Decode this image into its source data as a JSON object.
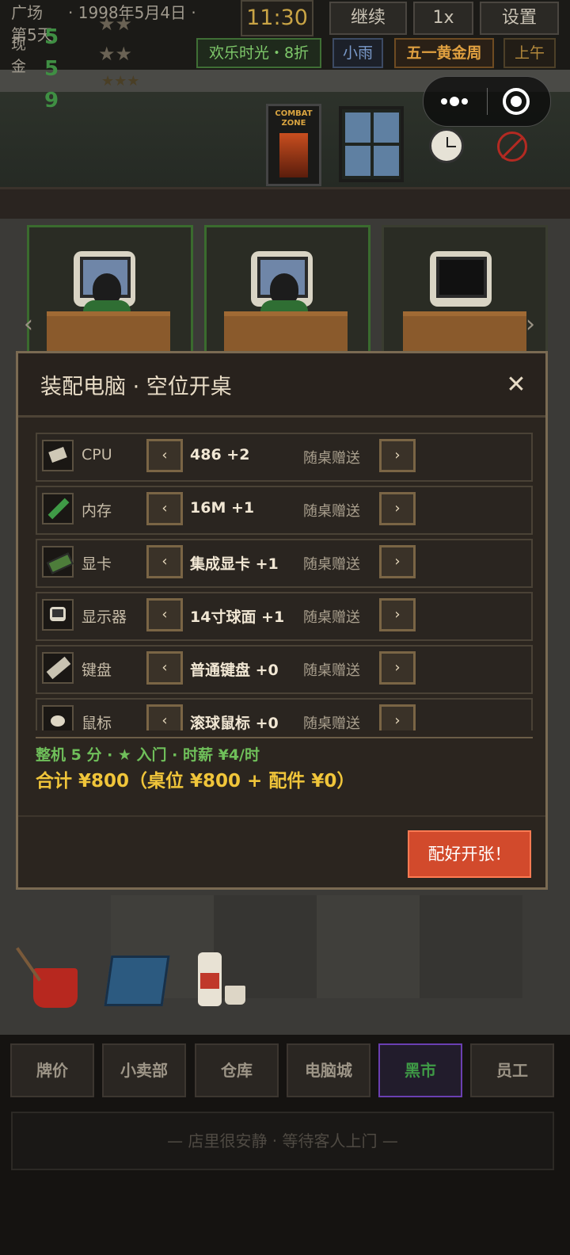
{
  "topbar": {
    "location": "广场",
    "date": "· 1998年5月4日 ·",
    "day": "第5天",
    "cash_label": "现金",
    "cash_digits": [
      "5",
      "5",
      "9"
    ],
    "stars_row1": "★★",
    "stars_row2": "★★",
    "stars_row3": "★★★",
    "clock": "11:30",
    "continue_label": "继续",
    "speed_label": "1x",
    "settings_label": "设置",
    "chip_happy": "欢乐时光・8折",
    "chip_weather": "小雨",
    "chip_event": "五一黄金周",
    "chip_time": "上午"
  },
  "scene": {
    "poster_text": "COMBAT ZONE",
    "nav_left": "‹",
    "nav_right": "›"
  },
  "modal": {
    "title": "装配电脑 · 空位开桌",
    "close": "✕",
    "prev": "‹",
    "next": "›",
    "components": [
      {
        "name": "CPU",
        "value": "486 +2",
        "note": "随桌赠送",
        "icon": "cpu-icon"
      },
      {
        "name": "内存",
        "value": "16M +1",
        "note": "随桌赠送",
        "icon": "ram-icon"
      },
      {
        "name": "显卡",
        "value": "集成显卡 +1",
        "note": "随桌赠送",
        "icon": "gpu-icon"
      },
      {
        "name": "显示器",
        "value": "14寸球面 +1",
        "note": "随桌赠送",
        "icon": "monitor-icon"
      },
      {
        "name": "键盘",
        "value": "普通键盘 +0",
        "note": "随桌赠送",
        "icon": "keyboard-icon"
      },
      {
        "name": "鼠标",
        "value": "滚球鼠标 +0",
        "note": "随桌赠送",
        "icon": "mouse-icon"
      }
    ],
    "summary_line1": "整机 5 分 · ★ 入门 · 时薪 ¥4/时",
    "summary_line2": "合计 ¥800（桌位 ¥800 + 配件 ¥0）",
    "confirm_label": "配好开张！"
  },
  "nav": {
    "items": [
      "牌价",
      "小卖部",
      "仓库",
      "电脑城",
      "黑市",
      "员工"
    ],
    "active_index": 4,
    "status": "— 店里很安静 · 等待客人上门 —"
  }
}
